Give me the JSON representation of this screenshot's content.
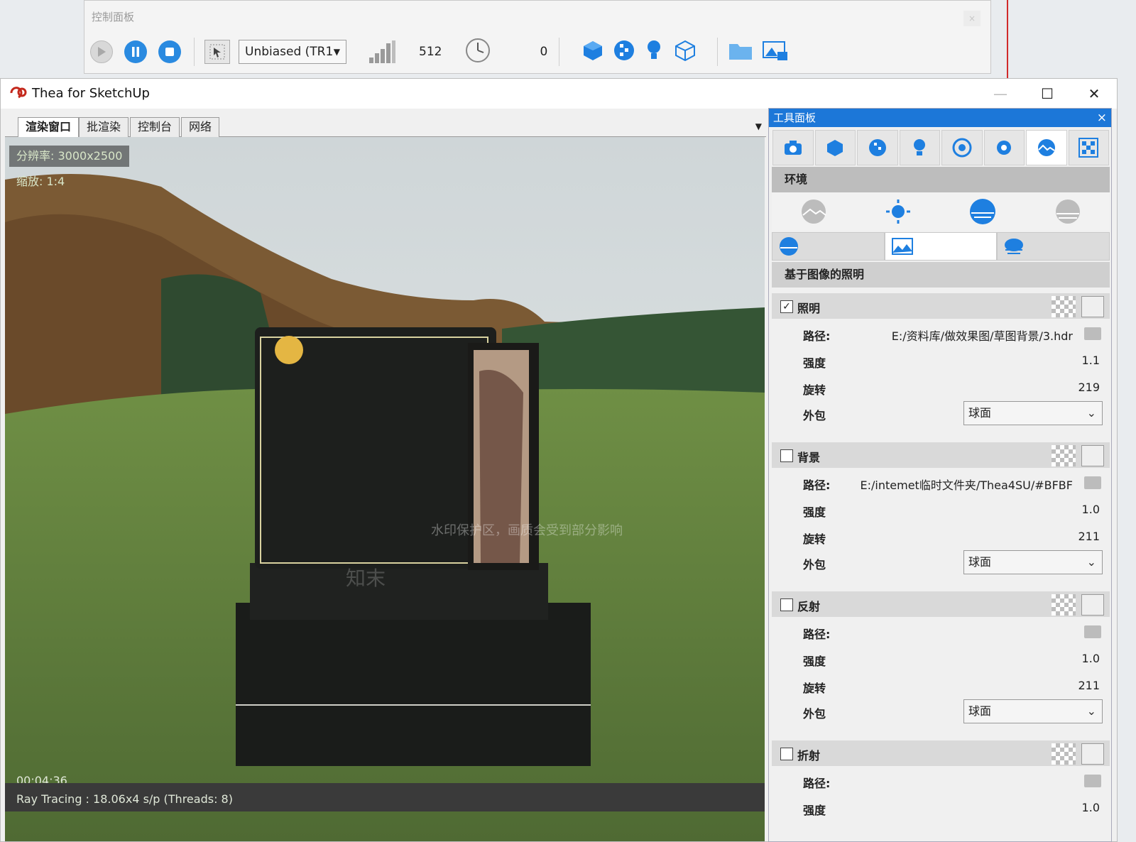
{
  "control_panel": {
    "title": "控制面板",
    "close": "×",
    "render_mode": "Unbiased (TR1",
    "passes": "512",
    "time": "0"
  },
  "window": {
    "title": "Thea for SketchUp",
    "minimize": "—",
    "maximize": "☐",
    "close": "✕"
  },
  "tabs": [
    {
      "label": "渲染窗口"
    },
    {
      "label": "批渲染"
    },
    {
      "label": "控制台"
    },
    {
      "label": "网络"
    }
  ],
  "render": {
    "resolution": "分辨率:  3000x2500",
    "zoom": "缩放:  1:4",
    "elapsed": "00:04:36",
    "status": "Ray Tracing : 18.06x4 s/p (Threads: 8)",
    "watermark": "水印保护区，画质会受到部分影响",
    "watermark_logo": "知末"
  },
  "tool_panel": {
    "title": "工具面板",
    "close": "×",
    "section": "环境",
    "subsection": "基于图像的照明",
    "groups": [
      {
        "label": "照明",
        "checked": true,
        "path_label": "路径:",
        "path": "E:/资料库/做效果图/草图背景/3.hdr",
        "intensity_label": "强度",
        "intensity": "1.1",
        "rotation_label": "旋转",
        "rotation": "219",
        "wrap_label": "外包",
        "wrap": "球面"
      },
      {
        "label": "背景",
        "checked": false,
        "path_label": "路径:",
        "path": "E:/intemet临时文件夹/Thea4SU/#BFBF",
        "intensity_label": "强度",
        "intensity": "1.0",
        "rotation_label": "旋转",
        "rotation": "211",
        "wrap_label": "外包",
        "wrap": "球面"
      },
      {
        "label": "反射",
        "checked": false,
        "path_label": "路径:",
        "path": "",
        "intensity_label": "强度",
        "intensity": "1.0",
        "rotation_label": "旋转",
        "rotation": "211",
        "wrap_label": "外包",
        "wrap": "球面"
      },
      {
        "label": "折射",
        "checked": false,
        "path_label": "路径:",
        "path": "",
        "intensity_label": "强度",
        "intensity": "1.0"
      }
    ]
  },
  "colors": {
    "accent": "#1c77d8",
    "title_bar": "#ffffff",
    "tab_active": "#ffffff"
  }
}
